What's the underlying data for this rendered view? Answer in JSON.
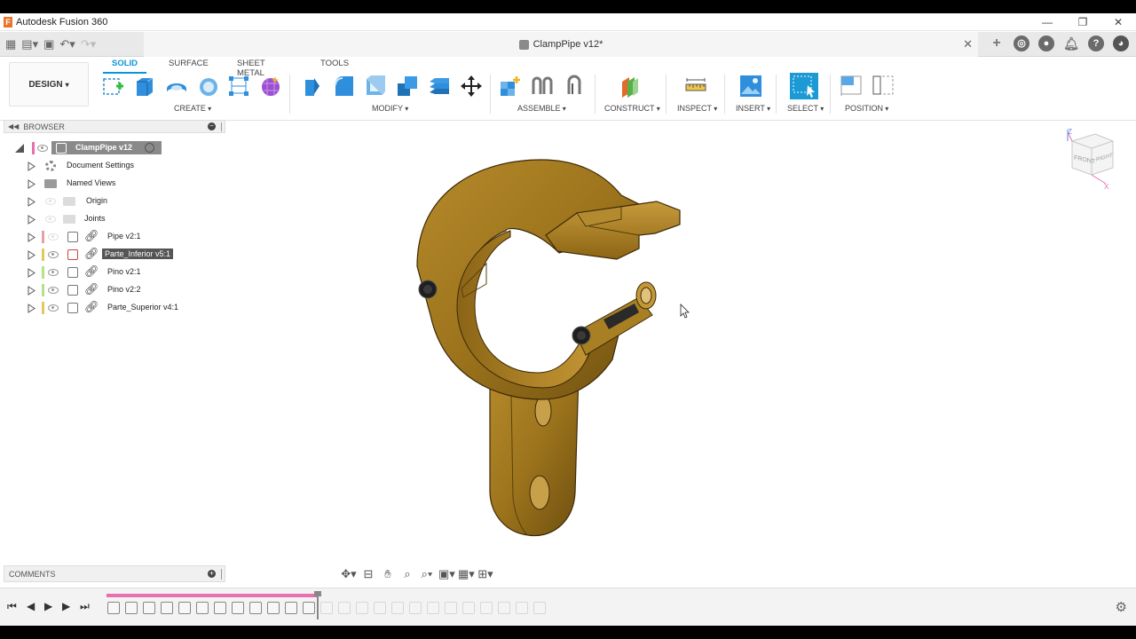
{
  "app": {
    "title": "Autodesk Fusion 360",
    "logo_letter": "F"
  },
  "window_controls": {
    "minimize": "—",
    "restore": "❐",
    "close": "✕"
  },
  "document": {
    "name": "ClampPipe v12*"
  },
  "workspace": {
    "label": "DESIGN"
  },
  "toolbar": {
    "tabs": [
      "SOLID",
      "SURFACE",
      "SHEET METAL",
      "TOOLS"
    ],
    "active_tab": "SOLID",
    "groups": [
      "CREATE",
      "MODIFY",
      "ASSEMBLE",
      "CONSTRUCT",
      "INSPECT",
      "INSERT",
      "SELECT",
      "POSITION"
    ]
  },
  "browser": {
    "title": "BROWSER",
    "root": "ClampPipe v12",
    "items": [
      {
        "label": "Document Settings",
        "icon": "gear-icon"
      },
      {
        "label": "Named Views",
        "icon": "folder-icon"
      },
      {
        "label": "Origin",
        "icon": "folder-icon"
      },
      {
        "label": "Joints",
        "icon": "folder-icon"
      },
      {
        "label": "Pipe v2:1",
        "icon": "component-icon",
        "color": "#e8a0a8"
      },
      {
        "label": "Parte_Inferior v5:1",
        "icon": "component-icon",
        "color": "#e6c85a",
        "selected": true
      },
      {
        "label": "Pino v2:1",
        "icon": "component-icon",
        "color": "#b8e088"
      },
      {
        "label": "Pino v2:2",
        "icon": "component-icon",
        "color": "#b8e088"
      },
      {
        "label": "Parte_Superior v4:1",
        "icon": "component-icon",
        "color": "#e6c85a"
      }
    ]
  },
  "comments": {
    "title": "COMMENTS"
  },
  "viewcube": {
    "front": "FRONT",
    "right": "RIGHT",
    "axis_z": "Z",
    "axis_x": "X"
  },
  "colors": {
    "accent": "#0696d7",
    "part": "#a47a1e",
    "timeline": "#e86fb1"
  }
}
